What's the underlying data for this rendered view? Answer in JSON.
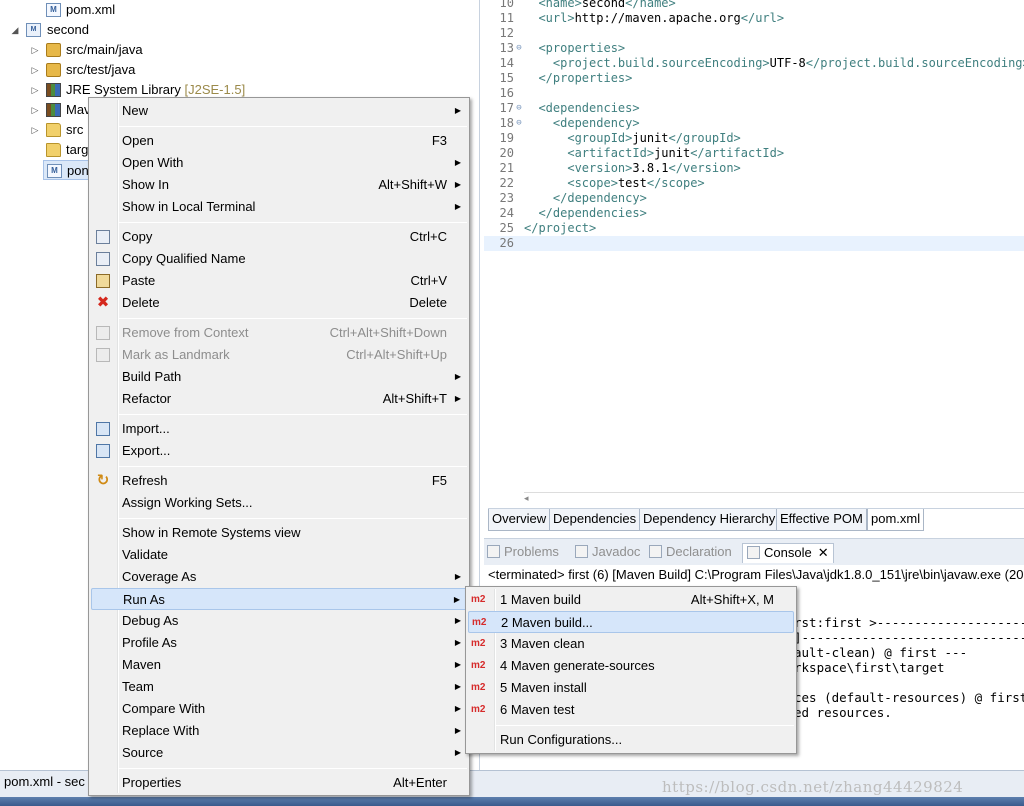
{
  "explorer": {
    "rows": [
      {
        "label": "pom.xml",
        "icon": "maven-file-icon"
      },
      {
        "label": "second",
        "icon": "maven-project-icon"
      },
      {
        "label": "src/main/java",
        "icon": "package-folder-icon"
      },
      {
        "label": "src/test/java",
        "icon": "package-folder-icon"
      },
      {
        "label": "JRE System Library",
        "decoration": "[J2SE-1.5]",
        "icon": "library-icon"
      },
      {
        "label": "Mav",
        "icon": "library-icon"
      },
      {
        "label": "src",
        "icon": "folder-icon"
      },
      {
        "label": "targ",
        "icon": "folder-icon"
      },
      {
        "label": "pon",
        "icon": "maven-file-icon"
      }
    ]
  },
  "status_bar": {
    "text": "pom.xml - sec"
  },
  "editor": {
    "lines": [
      {
        "n": "10",
        "pre": "  ",
        "parts": [
          {
            "t": "tag",
            "v": "<name>"
          },
          {
            "t": "txt",
            "v": "second"
          },
          {
            "t": "tag",
            "v": "</name>"
          }
        ]
      },
      {
        "n": "11",
        "pre": "  ",
        "parts": [
          {
            "t": "tag",
            "v": "<url>"
          },
          {
            "t": "txt",
            "v": "http://maven.apache.org"
          },
          {
            "t": "tag",
            "v": "</url>"
          }
        ]
      },
      {
        "n": "12",
        "pre": "",
        "parts": []
      },
      {
        "n": "13",
        "fold": "⊖",
        "pre": "  ",
        "parts": [
          {
            "t": "tag",
            "v": "<properties>"
          }
        ]
      },
      {
        "n": "14",
        "pre": "    ",
        "parts": [
          {
            "t": "tag",
            "v": "<project.build.sourceEncoding>"
          },
          {
            "t": "txt",
            "v": "UTF-8"
          },
          {
            "t": "tag",
            "v": "</project.build.sourceEncoding>"
          }
        ]
      },
      {
        "n": "15",
        "pre": "  ",
        "parts": [
          {
            "t": "tag",
            "v": "</properties>"
          }
        ]
      },
      {
        "n": "16",
        "pre": "",
        "parts": []
      },
      {
        "n": "17",
        "fold": "⊖",
        "pre": "  ",
        "parts": [
          {
            "t": "tag",
            "v": "<dependencies>"
          }
        ]
      },
      {
        "n": "18",
        "fold": "⊖",
        "pre": "    ",
        "parts": [
          {
            "t": "tag",
            "v": "<dependency>"
          }
        ]
      },
      {
        "n": "19",
        "pre": "      ",
        "parts": [
          {
            "t": "tag",
            "v": "<groupId>"
          },
          {
            "t": "txt",
            "v": "junit"
          },
          {
            "t": "tag",
            "v": "</groupId>"
          }
        ]
      },
      {
        "n": "20",
        "pre": "      ",
        "parts": [
          {
            "t": "tag",
            "v": "<artifactId>"
          },
          {
            "t": "txt",
            "v": "junit"
          },
          {
            "t": "tag",
            "v": "</artifactId>"
          }
        ]
      },
      {
        "n": "21",
        "pre": "      ",
        "parts": [
          {
            "t": "tag",
            "v": "<version>"
          },
          {
            "t": "txt",
            "v": "3.8.1"
          },
          {
            "t": "tag",
            "v": "</version>"
          }
        ]
      },
      {
        "n": "22",
        "pre": "      ",
        "parts": [
          {
            "t": "tag",
            "v": "<scope>"
          },
          {
            "t": "txt",
            "v": "test"
          },
          {
            "t": "tag",
            "v": "</scope>"
          }
        ]
      },
      {
        "n": "23",
        "pre": "    ",
        "parts": [
          {
            "t": "tag",
            "v": "</dependency>"
          }
        ]
      },
      {
        "n": "24",
        "pre": "  ",
        "parts": [
          {
            "t": "tag",
            "v": "</dependencies>"
          }
        ]
      },
      {
        "n": "25",
        "pre": "",
        "parts": [
          {
            "t": "tag",
            "v": "</project>"
          }
        ]
      },
      {
        "n": "26",
        "pre": "",
        "parts": [],
        "current": true
      }
    ],
    "scroll_arrow": "◂"
  },
  "editor_tabs": [
    "Overview",
    "Dependencies",
    "Dependency Hierarchy",
    "Effective POM",
    "pom.xml"
  ],
  "editor_active_tab": "pom.xml",
  "view_tabs": [
    {
      "label": "Problems",
      "active": false
    },
    {
      "label": "Javadoc",
      "active": false
    },
    {
      "label": "Declaration",
      "active": false
    },
    {
      "label": "Console",
      "active": true
    }
  ],
  "console": {
    "header": "<terminated> first (6) [Maven Build] C:\\Program Files\\Java\\jdk1.8.0_151\\jre\\bin\\javaw.exe (20",
    "lines": [
      "rst:first >-----------------------",
      "]-----------------------------------",
      "ault-clean) @ first ---",
      "rkspace\\first\\target",
      "",
      "ces (default-resources) @ first -",
      "ed resources."
    ],
    "close_glyph": "✕"
  },
  "watermark": "https://blog.csdn.net/zhang44429824",
  "context_menu": {
    "items": [
      {
        "label": "New",
        "submenu": true
      },
      {
        "sep": true
      },
      {
        "label": "Open",
        "accel": "F3"
      },
      {
        "label": "Open With",
        "submenu": true
      },
      {
        "label": "Show In",
        "accel": "Alt+Shift+W",
        "submenu": true
      },
      {
        "label": "Show in Local Terminal",
        "submenu": true
      },
      {
        "sep": true
      },
      {
        "label": "Copy",
        "accel": "Ctrl+C",
        "icon": "copy-icon"
      },
      {
        "label": "Copy Qualified Name",
        "icon": "copy-qualified-icon"
      },
      {
        "label": "Paste",
        "accel": "Ctrl+V",
        "icon": "paste-icon"
      },
      {
        "label": "Delete",
        "accel": "Delete",
        "icon": "delete-icon"
      },
      {
        "sep": true
      },
      {
        "label": "Remove from Context",
        "accel": "Ctrl+Alt+Shift+Down",
        "disabled": true,
        "icon": "remove-context-icon"
      },
      {
        "label": "Mark as Landmark",
        "accel": "Ctrl+Alt+Shift+Up",
        "disabled": true,
        "icon": "landmark-icon"
      },
      {
        "label": "Build Path",
        "submenu": true
      },
      {
        "label": "Refactor",
        "accel": "Alt+Shift+T",
        "submenu": true
      },
      {
        "sep": true
      },
      {
        "label": "Import...",
        "icon": "import-icon"
      },
      {
        "label": "Export...",
        "icon": "export-icon"
      },
      {
        "sep": true
      },
      {
        "label": "Refresh",
        "accel": "F5",
        "icon": "refresh-icon"
      },
      {
        "label": "Assign Working Sets..."
      },
      {
        "sep": true
      },
      {
        "label": "Show in Remote Systems view"
      },
      {
        "label": "Validate"
      },
      {
        "label": "Coverage As",
        "submenu": true
      },
      {
        "label": "Run As",
        "submenu": true,
        "highlighted": true
      },
      {
        "label": "Debug As",
        "submenu": true
      },
      {
        "label": "Profile As",
        "submenu": true
      },
      {
        "label": "Maven",
        "submenu": true
      },
      {
        "label": "Team",
        "submenu": true
      },
      {
        "label": "Compare With",
        "submenu": true
      },
      {
        "label": "Replace With",
        "submenu": true
      },
      {
        "label": "Source",
        "submenu": true
      },
      {
        "sep": true
      },
      {
        "label": "Properties",
        "accel": "Alt+Enter"
      }
    ]
  },
  "run_as_menu": {
    "items": [
      {
        "label": "1 Maven build",
        "accel": "Alt+Shift+X, M",
        "badge": "m2"
      },
      {
        "label": "2 Maven build...",
        "badge": "m2",
        "highlighted": true
      },
      {
        "label": "3 Maven clean",
        "badge": "m2"
      },
      {
        "label": "4 Maven generate-sources",
        "badge": "m2"
      },
      {
        "label": "5 Maven install",
        "badge": "m2"
      },
      {
        "label": "6 Maven test",
        "badge": "m2"
      },
      {
        "sep": true
      },
      {
        "label": "Run Configurations..."
      }
    ]
  }
}
